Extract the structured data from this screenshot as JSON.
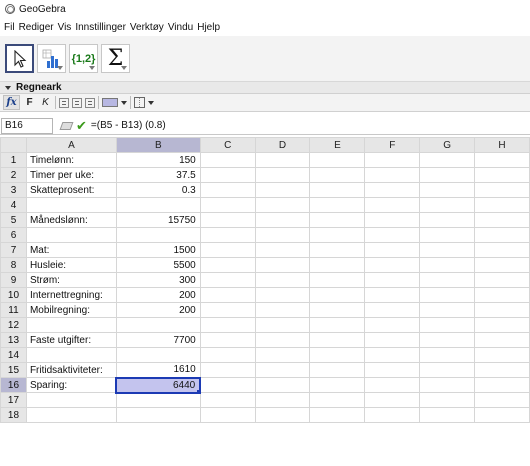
{
  "app": {
    "title": "GeoGebra"
  },
  "menu": [
    "Fil",
    "Rediger",
    "Vis",
    "Innstillinger",
    "Verktøy",
    "Vindu",
    "Hjelp"
  ],
  "toolbar": {
    "tools": [
      {
        "name": "move-tool",
        "icon": "arrow-cursor-icon",
        "selected": true
      },
      {
        "name": "spreadsheet-tool",
        "icon": "bar-chart-icon",
        "selected": false
      },
      {
        "name": "list-tool",
        "icon": "list-braces-icon",
        "label": "{1,2}",
        "selected": false
      },
      {
        "name": "sum-tool",
        "icon": "sigma-icon",
        "label": "Σ",
        "selected": false
      }
    ]
  },
  "view": {
    "title": "Regneark"
  },
  "style_bar": {
    "fx": "fx",
    "bold": "F",
    "italic": "K"
  },
  "input_bar": {
    "cell_ref": "B16",
    "formula": "=(B5 - B13) (0.8)"
  },
  "columns": [
    "A",
    "B",
    "C",
    "D",
    "E",
    "F",
    "G",
    "H"
  ],
  "selected_cell": {
    "col": "B",
    "row": 16
  },
  "rows": [
    {
      "num": "1",
      "a": "Timelønn:",
      "b": "150"
    },
    {
      "num": "2",
      "a": "Timer per uke:",
      "b": "37.5"
    },
    {
      "num": "3",
      "a": "Skatteprosent:",
      "b": "0.3"
    },
    {
      "num": "4",
      "a": "",
      "b": ""
    },
    {
      "num": "5",
      "a": "Månedslønn:",
      "b": "15750"
    },
    {
      "num": "6",
      "a": "",
      "b": ""
    },
    {
      "num": "7",
      "a": "Mat:",
      "b": "1500"
    },
    {
      "num": "8",
      "a": "Husleie:",
      "b": "5500"
    },
    {
      "num": "9",
      "a": "Strøm:",
      "b": "300"
    },
    {
      "num": "10",
      "a": "Internettregning:",
      "b": "200"
    },
    {
      "num": "11",
      "a": "Mobilregning:",
      "b": "200"
    },
    {
      "num": "12",
      "a": "",
      "b": ""
    },
    {
      "num": "13",
      "a": "Faste utgifter:",
      "b": "7700"
    },
    {
      "num": "14",
      "a": "",
      "b": ""
    },
    {
      "num": "15",
      "a": "Fritidsaktiviteter:",
      "b": "1610"
    },
    {
      "num": "16",
      "a": "Sparing:",
      "b": "6440"
    },
    {
      "num": "17",
      "a": "",
      "b": ""
    },
    {
      "num": "18",
      "a": "",
      "b": ""
    }
  ],
  "colors": {
    "selection": "#c4c4ee",
    "selection_border": "#1c3ab4",
    "header_bg": "#e6e6e6"
  }
}
